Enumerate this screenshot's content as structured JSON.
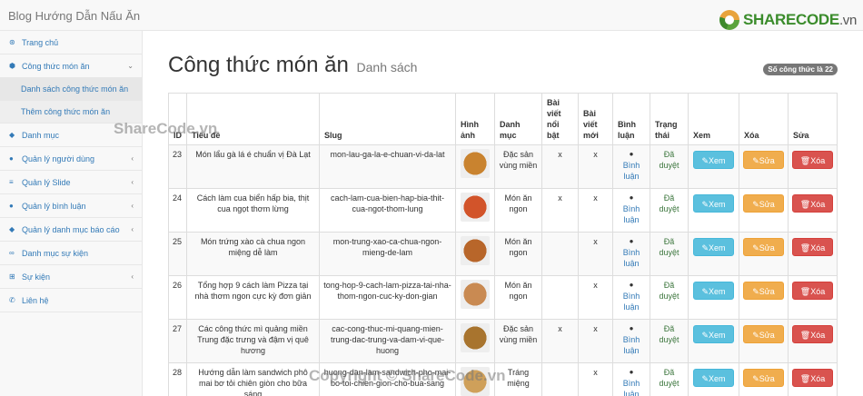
{
  "brand": "Blog Hướng Dẫn Nấu Ăn",
  "logo": {
    "main": "SHARECODE",
    "suffix": ".vn"
  },
  "sidebar": {
    "items": [
      {
        "label": "Trang chủ",
        "icon": "dashboard-icon",
        "glyph": "⊛",
        "sub": false,
        "chevron": false,
        "chevron_glyph": ""
      },
      {
        "label": "Công thức món ăn",
        "icon": "cube-icon",
        "glyph": "⬢",
        "sub": false,
        "chevron": true,
        "chevron_glyph": "⌄"
      },
      {
        "label": "Danh sách công thức món ăn",
        "icon": "",
        "glyph": "",
        "sub": true,
        "active": true
      },
      {
        "label": "Thêm công thức món ăn",
        "icon": "",
        "glyph": "",
        "sub": true,
        "active": false
      },
      {
        "label": "Danh mục",
        "icon": "tag-icon",
        "glyph": "◆",
        "sub": false,
        "chevron": false,
        "chevron_glyph": ""
      },
      {
        "label": "Quản lý người dùng",
        "icon": "users-icon",
        "glyph": "●",
        "sub": false,
        "chevron": true,
        "chevron_glyph": "‹"
      },
      {
        "label": "Quản lý Slide",
        "icon": "sliders-icon",
        "glyph": "≡",
        "sub": false,
        "chevron": true,
        "chevron_glyph": "‹"
      },
      {
        "label": "Quản lý bình luận",
        "icon": "comments-icon",
        "glyph": "●",
        "sub": false,
        "chevron": true,
        "chevron_glyph": "‹"
      },
      {
        "label": "Quản lý danh mục báo cáo",
        "icon": "tags-icon",
        "glyph": "◆",
        "sub": false,
        "chevron": true,
        "chevron_glyph": "‹"
      },
      {
        "label": "Danh mục sự kiện",
        "icon": "link-icon",
        "glyph": "∞",
        "sub": false,
        "chevron": false,
        "chevron_glyph": ""
      },
      {
        "label": "Sự kiện",
        "icon": "sitemap-icon",
        "glyph": "⊞",
        "sub": false,
        "chevron": true,
        "chevron_glyph": "‹"
      },
      {
        "label": "Liên hệ",
        "icon": "phone-icon",
        "glyph": "✆",
        "sub": false,
        "chevron": false,
        "chevron_glyph": ""
      }
    ]
  },
  "page": {
    "title": "Công thức món ăn",
    "subtitle": "Danh sách",
    "count_badge": "Số công thức là 22"
  },
  "table": {
    "headers": [
      "ID",
      "Tiêu đề",
      "Slug",
      "Hình ảnh",
      "Danh mục",
      "Bài viết nổi bật",
      "Bài viết mới",
      "Bình luận",
      "Trạng thái",
      "Xem",
      "Xóa",
      "Sửa"
    ],
    "comment_link": "Bình luận",
    "btn_view": "Xem",
    "btn_edit": "Sửa",
    "btn_delete": "Xóa",
    "rows": [
      {
        "id": "23",
        "title": "Món lẩu gà lá é chuẩn vị Đà Lạt",
        "slug": "mon-lau-ga-la-e-chuan-vi-da-lat",
        "category": "Đặc sản vùng miền",
        "featured": "x",
        "new": "x",
        "status": "Đã duyệt",
        "img": "#c9832f"
      },
      {
        "id": "24",
        "title": "Cách làm cua biển hấp bia, thịt cua ngọt thơm lừng",
        "slug": "cach-lam-cua-bien-hap-bia-thit-cua-ngot-thom-lung",
        "category": "Món ăn ngon",
        "featured": "x",
        "new": "x",
        "status": "Đã duyệt",
        "img": "#d2542a"
      },
      {
        "id": "25",
        "title": "Món trứng xào cà chua ngon miệng dễ làm",
        "slug": "mon-trung-xao-ca-chua-ngon-mieng-de-lam",
        "category": "Món ăn ngon",
        "featured": "",
        "new": "x",
        "status": "Đã duyệt",
        "img": "#b8662a"
      },
      {
        "id": "26",
        "title": "Tổng hợp 9 cách làm Pizza tại nhà thơm ngon cực kỳ đơn giản",
        "slug": "tong-hop-9-cach-lam-pizza-tai-nha-thom-ngon-cuc-ky-don-gian",
        "category": "Món ăn ngon",
        "featured": "",
        "new": "x",
        "status": "Đã duyệt",
        "img": "#c98a52"
      },
      {
        "id": "27",
        "title": "Các công thức mì quảng miền Trung đặc trưng và đậm vị quê hương",
        "slug": "cac-cong-thuc-mi-quang-mien-trung-dac-trung-va-dam-vi-que-huong",
        "category": "Đặc sản vùng miền",
        "featured": "x",
        "new": "x",
        "status": "Đã duyệt",
        "img": "#a8742e"
      },
      {
        "id": "28",
        "title": "Hướng dẫn làm sandwich phô mai bơ tỏi chiên giòn cho bữa sáng",
        "slug": "huong-dan-lam-sandwich-pho-mai-bo-toi-chien-gion-cho-bua-sang",
        "category": "Tráng miệng",
        "featured": "",
        "new": "x",
        "status": "Đã duyệt",
        "img": "#cfa05a"
      }
    ]
  },
  "watermark": "ShareCode.vn",
  "copyright": "Copyright © ShareCode.vn"
}
